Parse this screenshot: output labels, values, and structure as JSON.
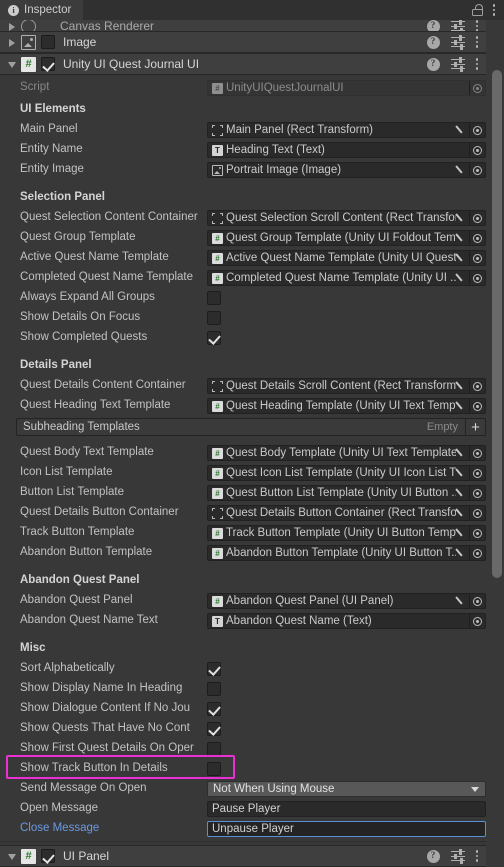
{
  "window": {
    "tab_label": "Inspector",
    "tab_icon": "info-icon",
    "lock_icon": "lock-open-icon",
    "menu_icon": "kebab-menu-icon"
  },
  "components": [
    {
      "title": "Canvas Renderer",
      "icon": "canvas-renderer-icon",
      "expanded": false,
      "enabled": null
    },
    {
      "title": "Image",
      "icon": "image-icon",
      "expanded": false,
      "enabled": false
    },
    {
      "title": "Unity UI Quest Journal UI",
      "icon": "script-icon",
      "expanded": true,
      "enabled": true
    },
    {
      "title": "UI Panel",
      "icon": "script-icon",
      "expanded": true,
      "enabled": true
    }
  ],
  "script_row": {
    "label": "Script",
    "value": "UnityUIQuestJournalUI",
    "disabled": true
  },
  "sections": {
    "ui_elements": {
      "header": "UI Elements",
      "fields": [
        {
          "label": "Main Panel",
          "value": "Main Panel (Rect Transform)",
          "icon": "rect-transform-icon",
          "has_pencil": true
        },
        {
          "label": "Entity Name",
          "value": "Heading Text (Text)",
          "icon": "text-icon",
          "has_pencil": false
        },
        {
          "label": "Entity Image",
          "value": "Portrait Image (Image)",
          "icon": "image-icon",
          "has_pencil": true
        }
      ]
    },
    "selection_panel": {
      "header": "Selection Panel",
      "fields": [
        {
          "label": "Quest Selection Content Container",
          "value": "Quest Selection Scroll Content (Rect Transform)",
          "icon": "rect-transform-icon",
          "has_pencil": true
        },
        {
          "label": "Quest Group Template",
          "value": "Quest Group Template (Unity UI Foldout Template)",
          "icon": "script-icon",
          "has_pencil": true
        },
        {
          "label": "Active Quest Name Template",
          "value": "Active Quest Name Template (Unity UI Quest Name Template)",
          "icon": "script-icon",
          "has_pencil": true
        },
        {
          "label": "Completed Quest Name Template",
          "value": "Completed Quest Name Template (Unity UI ...)",
          "icon": "script-icon",
          "has_pencil": true
        }
      ],
      "toggles": [
        {
          "label": "Always Expand All Groups",
          "checked": false
        },
        {
          "label": "Show Details On Focus",
          "checked": false
        },
        {
          "label": "Show Completed Quests",
          "checked": true
        }
      ]
    },
    "details_panel": {
      "header": "Details Panel",
      "fields_top": [
        {
          "label": "Quest Details Content Container",
          "value": "Quest Details Scroll Content (Rect Transform)",
          "icon": "rect-transform-icon",
          "has_pencil": true
        },
        {
          "label": "Quest Heading Text Template",
          "value": "Quest Heading Template (Unity UI Text Template)",
          "icon": "script-icon",
          "has_pencil": true
        }
      ],
      "array": {
        "name": "Subheading Templates",
        "size_label": "Empty",
        "add_label": "+"
      },
      "fields_bottom": [
        {
          "label": "Quest Body Text Template",
          "value": "Quest Body Template (Unity UI Text Template)",
          "icon": "script-icon",
          "has_pencil": true
        },
        {
          "label": "Icon List Template",
          "value": "Quest Icon List Template (Unity UI Icon List T...)",
          "icon": "script-icon",
          "has_pencil": true
        },
        {
          "label": "Button List Template",
          "value": "Quest Button List Template (Unity UI Button ...)",
          "icon": "script-icon",
          "has_pencil": true
        },
        {
          "label": "Quest Details Button Container",
          "value": "Quest Details Button Container (Rect Transform)",
          "icon": "rect-transform-icon",
          "has_pencil": true
        },
        {
          "label": "Track Button Template",
          "value": "Track Button Template (Unity UI Button Template)",
          "icon": "script-icon",
          "has_pencil": true
        },
        {
          "label": "Abandon Button Template",
          "value": "Abandon Button Template (Unity UI Button T...)",
          "icon": "script-icon",
          "has_pencil": true
        }
      ]
    },
    "abandon_quest_panel": {
      "header": "Abandon Quest Panel",
      "fields": [
        {
          "label": "Abandon Quest Panel",
          "value": "Abandon Quest Panel (UI Panel)",
          "icon": "script-icon",
          "has_pencil": true
        },
        {
          "label": "Abandon Quest Name Text",
          "value": "Abandon Quest Name (Text)",
          "icon": "text-icon",
          "has_pencil": false
        }
      ]
    },
    "misc": {
      "header": "Misc",
      "toggles": [
        {
          "label": "Sort Alphabetically",
          "checked": true
        },
        {
          "label": "Show Display Name In Heading",
          "checked": false
        },
        {
          "label": "Show Dialogue Content If No Jou",
          "checked": true
        },
        {
          "label": "Show Quests That Have No Cont",
          "checked": true
        },
        {
          "label": "Show First Quest Details On Oper",
          "checked": false
        },
        {
          "label": "Show Track Button In Details",
          "checked": false,
          "highlighted": true
        }
      ],
      "dropdown": {
        "label": "Send Message On Open",
        "value": "Not When Using Mouse"
      },
      "open_message": {
        "label": "Open Message",
        "value": "Pause Player"
      },
      "close_message": {
        "label": "Close Message",
        "value": "Unpause Player",
        "focused": true,
        "label_blue": true
      }
    }
  },
  "colors": {
    "highlight": "#ea2fd4",
    "focus_border": "#5a8fd6",
    "panel_bg": "#383838",
    "field_bg": "#2a2a2a"
  }
}
